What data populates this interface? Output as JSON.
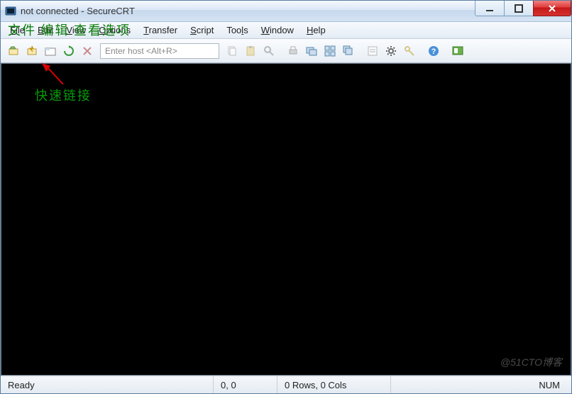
{
  "titlebar": {
    "title": "not connected - SecureCRT"
  },
  "overlay": {
    "line1": "文件   编辑   查看选项",
    "line2": "快速链接"
  },
  "menubar": {
    "items": [
      {
        "label": "File",
        "key": "F"
      },
      {
        "label": "Edit",
        "key": "E"
      },
      {
        "label": "View",
        "key": "V"
      },
      {
        "label": "Options",
        "key": "O"
      },
      {
        "label": "Transfer",
        "key": "T"
      },
      {
        "label": "Script",
        "key": "S"
      },
      {
        "label": "Tools",
        "key": "l"
      },
      {
        "label": "Window",
        "key": "W"
      },
      {
        "label": "Help",
        "key": "H"
      }
    ]
  },
  "toolbar": {
    "host_placeholder": "Enter host <Alt+R>"
  },
  "statusbar": {
    "ready": "Ready",
    "coord": "0, 0",
    "rowscols": "0 Rows, 0 Cols",
    "num": "NUM"
  },
  "watermark": "@51CTO博客"
}
